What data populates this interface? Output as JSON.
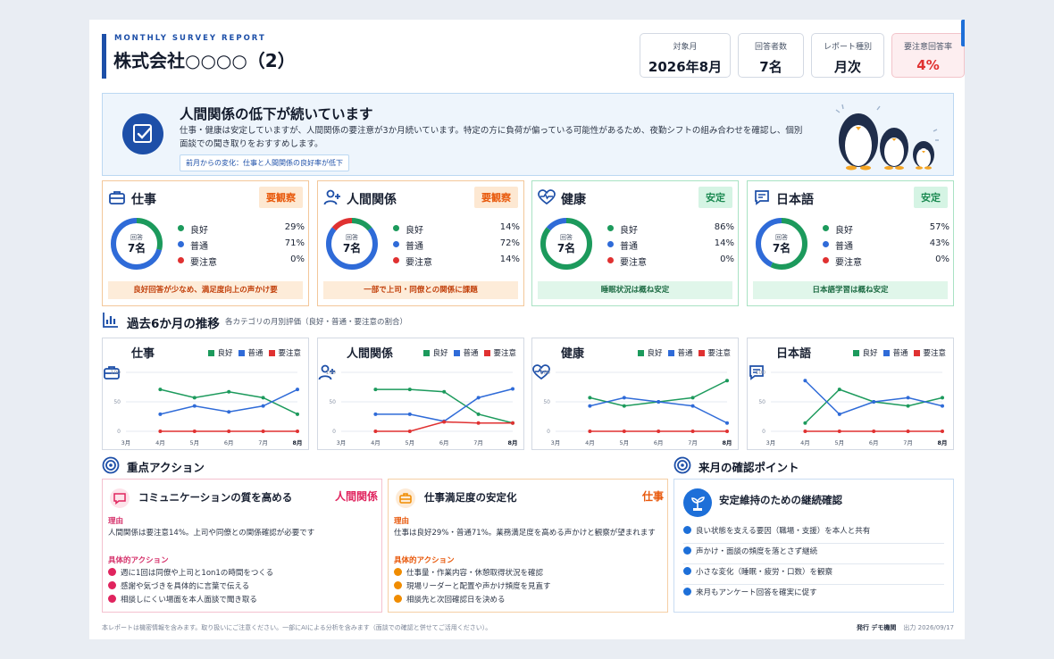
{
  "header": {
    "subtitle": "MONTHLY SURVEY REPORT",
    "title": "株式会社○○○○（2）",
    "stats": [
      {
        "label": "対象月",
        "value": "2026年8月"
      },
      {
        "label": "回答者数",
        "value": "7名"
      },
      {
        "label": "レポート種別",
        "value": "月次"
      },
      {
        "label": "要注意回答率",
        "value": "4%"
      }
    ]
  },
  "banner": {
    "title": "人間関係の低下が続いています",
    "text": "仕事・健康は安定していますが、人間関係の要注意が3か月続いています。特定の方に負荷が偏っている可能性があるため、夜勤シフトの組み合わせを確認し、個別面談での聞き取りをおすすめします。",
    "chip": "前月からの変化：仕事と人間関係の良好率が低下",
    "icon": "checklist-icon",
    "illustration": "penguin-family-illustration"
  },
  "colors": {
    "good": "#1c9a5c",
    "normal": "#2f6bd8",
    "caution": "#e03131",
    "brand": "#1d4fa8"
  },
  "cards": [
    {
      "title": "仕事",
      "badge": "要観察",
      "icon": "briefcase-icon",
      "center_label": "回答",
      "center_value": "7名",
      "good": "29%",
      "normal": "71%",
      "caution": "0%",
      "good_v": 29,
      "normal_v": 71,
      "caution_v": 0,
      "note": "良好回答が少なめ、満足度向上の声かけ要"
    },
    {
      "title": "人間関係",
      "badge": "要観察",
      "icon": "user-plus-icon",
      "center_label": "回答",
      "center_value": "7名",
      "good": "14%",
      "normal": "72%",
      "caution": "14%",
      "good_v": 14,
      "normal_v": 72,
      "caution_v": 14,
      "note": "一部で上司・同僚との関係に課題"
    },
    {
      "title": "健康",
      "badge": "安定",
      "icon": "heart-pulse-icon",
      "center_label": "回答",
      "center_value": "7名",
      "good": "86%",
      "normal": "14%",
      "caution": "0%",
      "good_v": 86,
      "normal_v": 14,
      "caution_v": 0,
      "note": "睡眠状況は概ね安定"
    },
    {
      "title": "日本語",
      "badge": "安定",
      "icon": "chat-icon",
      "center_label": "回答",
      "center_value": "7名",
      "good": "57%",
      "normal": "43%",
      "caution": "0%",
      "good_v": 57,
      "normal_v": 43,
      "caution_v": 0,
      "note": "日本語学習は概ね安定"
    }
  ],
  "legend": {
    "good": "良好",
    "normal": "普通",
    "caution": "要注意"
  },
  "trends_section": {
    "title": "過去6か月の推移",
    "subtitle": "各カテゴリの月別評価（良好・普通・要注意の割合）"
  },
  "chart_data": [
    {
      "type": "line",
      "title": "仕事",
      "x": [
        "3月",
        "4月",
        "5月",
        "6月",
        "7月",
        "8月"
      ],
      "ylim": [
        0,
        100
      ],
      "yticks": [
        "0",
        "50",
        "100"
      ],
      "series": [
        {
          "name": "良好",
          "values": [
            null,
            71,
            57,
            67,
            57,
            29
          ]
        },
        {
          "name": "普通",
          "values": [
            null,
            29,
            43,
            33,
            43,
            71
          ]
        },
        {
          "name": "要注意",
          "values": [
            null,
            0,
            0,
            0,
            0,
            0
          ]
        }
      ]
    },
    {
      "type": "line",
      "title": "人間関係",
      "x": [
        "3月",
        "4月",
        "5月",
        "6月",
        "7月",
        "8月"
      ],
      "ylim": [
        0,
        100
      ],
      "yticks": [
        "0",
        "50",
        "100"
      ],
      "series": [
        {
          "name": "良好",
          "values": [
            null,
            71,
            71,
            67,
            29,
            14
          ]
        },
        {
          "name": "普通",
          "values": [
            null,
            29,
            29,
            17,
            57,
            72
          ]
        },
        {
          "name": "要注意",
          "values": [
            null,
            0,
            0,
            16,
            14,
            14
          ]
        }
      ]
    },
    {
      "type": "line",
      "title": "健康",
      "x": [
        "3月",
        "4月",
        "5月",
        "6月",
        "7月",
        "8月"
      ],
      "ylim": [
        0,
        100
      ],
      "yticks": [
        "0",
        "50",
        "100"
      ],
      "series": [
        {
          "name": "良好",
          "values": [
            null,
            57,
            43,
            50,
            57,
            86
          ]
        },
        {
          "name": "普通",
          "values": [
            null,
            43,
            57,
            50,
            43,
            14
          ]
        },
        {
          "name": "要注意",
          "values": [
            null,
            0,
            0,
            0,
            0,
            0
          ]
        }
      ]
    },
    {
      "type": "line",
      "title": "日本語",
      "x": [
        "3月",
        "4月",
        "5月",
        "6月",
        "7月",
        "8月"
      ],
      "ylim": [
        0,
        100
      ],
      "yticks": [
        "0",
        "50",
        "100"
      ],
      "series": [
        {
          "name": "良好",
          "values": [
            null,
            14,
            71,
            50,
            43,
            57
          ]
        },
        {
          "name": "普通",
          "values": [
            null,
            86,
            29,
            50,
            57,
            43
          ]
        },
        {
          "name": "要注意",
          "values": [
            null,
            0,
            0,
            0,
            0,
            0
          ]
        }
      ]
    }
  ],
  "actions_section": {
    "title": "重点アクション"
  },
  "actions": [
    {
      "title": "コミュニケーションの質を高める",
      "category": "人間関係",
      "icon": "chat-icon",
      "reason_label": "理由",
      "reason": "人間関係は要注意14%。上司や同僚との関係確認が必要です",
      "items_label": "具体的アクション",
      "items": [
        "週に1回は同僚や上司と1on1の時間をつくる",
        "感謝や気づきを具体的に言葉で伝える",
        "相談しにくい場面を本人面談で聞き取る"
      ]
    },
    {
      "title": "仕事満足度の安定化",
      "category": "仕事",
      "icon": "briefcase-icon",
      "reason_label": "理由",
      "reason": "仕事は良好29%・普通71%。業務満足度を高める声かけと観察が望まれます",
      "items_label": "具体的アクション",
      "items": [
        "仕事量・作業内容・休憩取得状況を確認",
        "現場リーダーと配置や声かけ頻度を見直す",
        "相談先と次回確認日を決める"
      ]
    }
  ],
  "next_section": {
    "title": "来月の確認ポイント",
    "card_title": "安定維持のための継続確認",
    "icon": "plant-icon",
    "items": [
      "良い状態を支える要因（職場・支援）を本人と共有",
      "声かけ・面談の頻度を落とさず継続",
      "小さな変化（睡眠・疲労・口数）を観察",
      "来月もアンケート回答を確実に促す"
    ]
  },
  "footer": {
    "note": "本レポートは機密情報を含みます。取り扱いにご注意ください。一部にAIによる分析を含みます（面談での確認と併せてご活用ください）。",
    "issuer": "発行 デモ機関",
    "date": "出力 2026/09/17"
  }
}
